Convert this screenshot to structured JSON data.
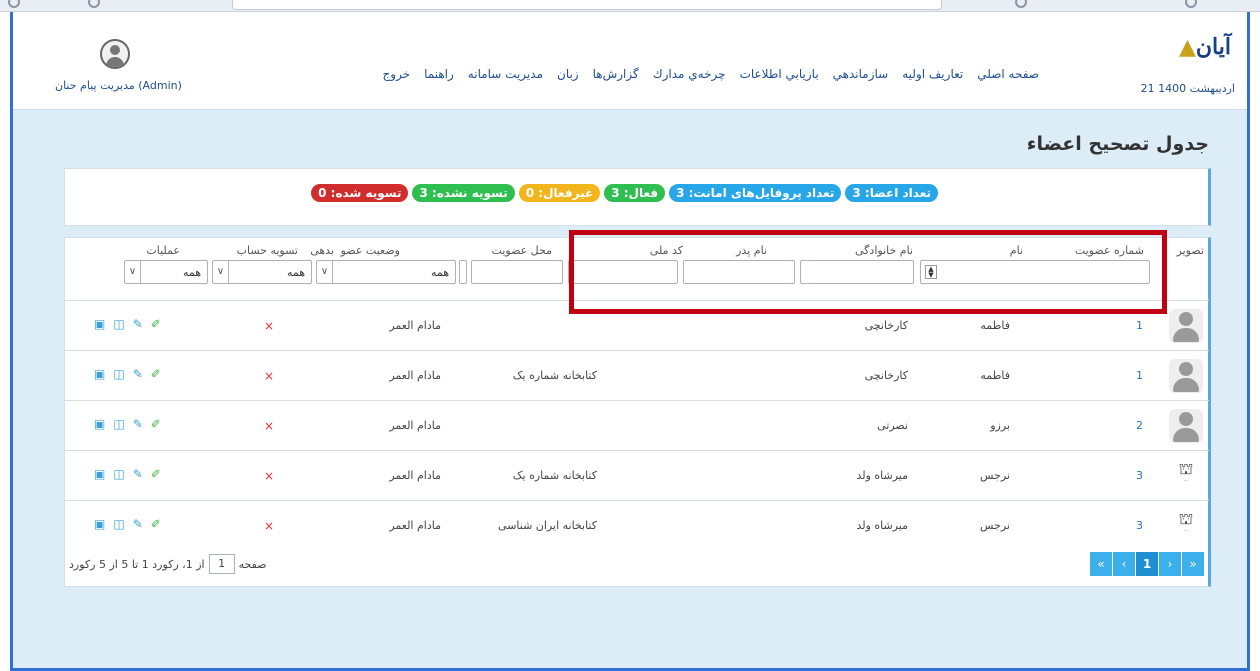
{
  "header": {
    "logo": "آیان",
    "date": "21 اردیبهشت 1400",
    "user": "مدیریت پیام حنان (Admin)",
    "nav": [
      "صفحه اصلي",
      "تعاريف اوليه",
      "سازماندهي",
      "بازيابي اطلاعات",
      "چرخه‌ي مدارك",
      "گزارش‌ها",
      "زبان",
      "مديريت سامانه",
      "راهنما",
      "خروج"
    ]
  },
  "page_title": "جدول تصحیح اعضاء",
  "badges": {
    "members": "تعداد اعضا: 3",
    "loan_profiles": "تعداد پروفایل‌های امانت: 3",
    "active": "فعال: 3",
    "inactive": "غیرفعال: 0",
    "unsettled": "تسویه نشده: 3",
    "settled": "تسویه شده: 0"
  },
  "badge_colors": {
    "members": "#27a6e8",
    "loan_profiles": "#27a6e8",
    "active": "#2fbf50",
    "inactive": "#f2b51c",
    "unsettled": "#2fbf50",
    "settled": "#d22d2d"
  },
  "columns": {
    "photo": "تصویر",
    "member_no": "شماره عضویت",
    "first_name": "نام",
    "last_name": "نام خانوادگی",
    "father": "نام پدر",
    "national_id": "کد ملی",
    "location": "محل عضویت",
    "status": "وضعیت عضو",
    "debt": "بدهی",
    "settle": "تسویه حساب",
    "ops": "عملیات"
  },
  "filters": {
    "location_select": "همه",
    "status_select": "همه",
    "settle_select": "همه"
  },
  "rows": [
    {
      "photo": "person",
      "member_no": "1",
      "first_name": "فاطمه",
      "last_name": "کارخانچی",
      "location": "",
      "status": "مادام العمر",
      "settle": "×"
    },
    {
      "photo": "person",
      "member_no": "1",
      "first_name": "فاطمه",
      "last_name": "کارخانچی",
      "location": "کتابخانه شماره یک",
      "status": "مادام العمر",
      "settle": "×"
    },
    {
      "photo": "person",
      "member_no": "2",
      "first_name": "برزو",
      "last_name": "نصرتی",
      "location": "",
      "status": "مادام العمر",
      "settle": "×"
    },
    {
      "photo": "logo",
      "member_no": "3",
      "first_name": "نرجس",
      "last_name": "میرشاه ولد",
      "location": "کتابخانه شماره یک",
      "status": "مادام العمر",
      "settle": "×"
    },
    {
      "photo": "logo",
      "member_no": "3",
      "first_name": "نرجس",
      "last_name": "میرشاه ولد",
      "location": "کتابخانه ایران شناسی",
      "status": "مادام العمر",
      "settle": "×"
    }
  ],
  "pager": {
    "page_label": "صفحه",
    "page_value": "1",
    "summary": "از 1، رکورد 1 تا 5 از 5 رکورد",
    "first": "«",
    "prev": "‹",
    "current": "1",
    "next": "›",
    "last": "»"
  },
  "icons": {
    "ops": [
      "clipboard-icon",
      "camera-icon",
      "edit-icon",
      "pencil-icon"
    ]
  }
}
